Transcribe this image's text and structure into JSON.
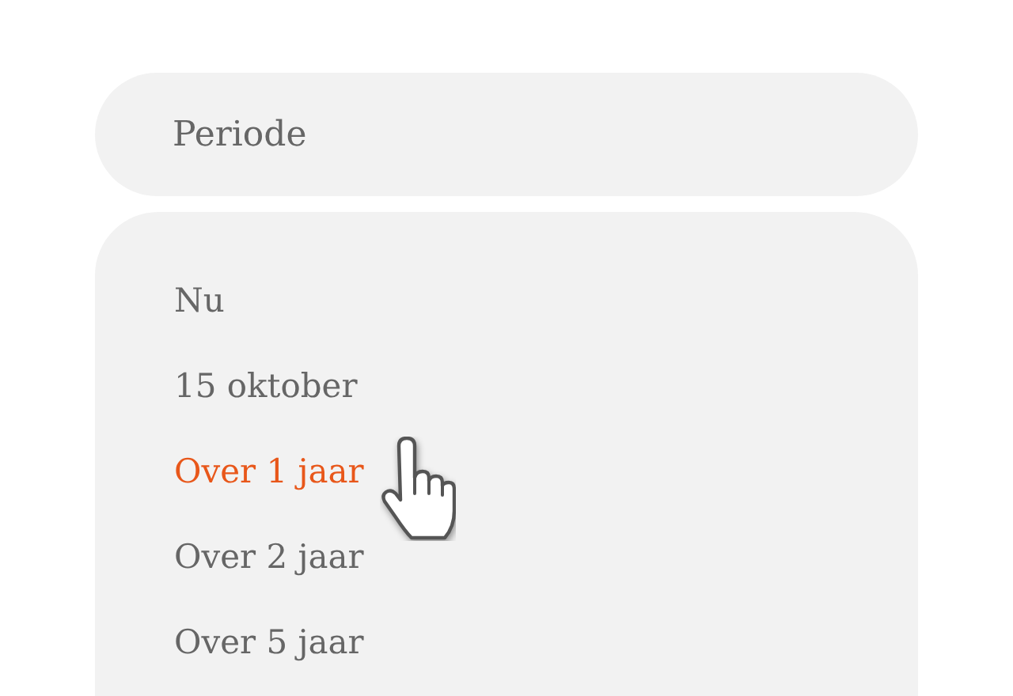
{
  "field": {
    "label": "Periode"
  },
  "options": [
    {
      "label": "Nu",
      "selected": false
    },
    {
      "label": "15 oktober",
      "selected": false
    },
    {
      "label": "Over 1 jaar",
      "selected": true
    },
    {
      "label": "Over 2 jaar",
      "selected": false
    },
    {
      "label": "Over 5 jaar",
      "selected": false
    }
  ]
}
